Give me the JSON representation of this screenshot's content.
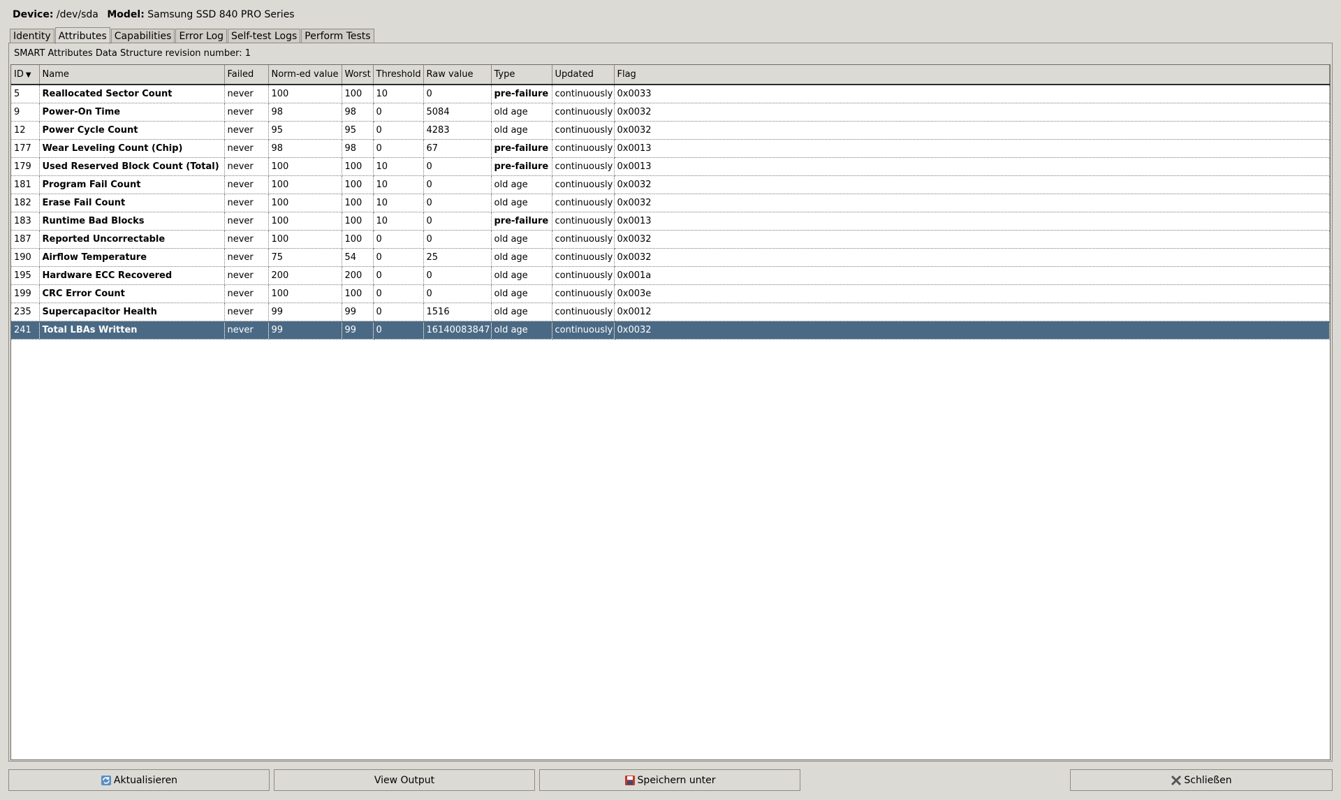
{
  "device": {
    "device_label": "Device:",
    "device_value": "/dev/sda",
    "model_label": "Model:",
    "model_value": "Samsung SSD 840 PRO Series"
  },
  "tabs": [
    {
      "label": "Identity",
      "active": false
    },
    {
      "label": "Attributes",
      "active": true
    },
    {
      "label": "Capabilities",
      "active": false
    },
    {
      "label": "Error Log",
      "active": false
    },
    {
      "label": "Self-test Logs",
      "active": false
    },
    {
      "label": "Perform Tests",
      "active": false
    }
  ],
  "revision_text": "SMART Attributes Data Structure revision number: 1",
  "table": {
    "columns": [
      "ID",
      "Name",
      "Failed",
      "Norm-ed value",
      "Worst",
      "Threshold",
      "Raw value",
      "Type",
      "Updated",
      "Flag"
    ],
    "sort_indicator": "▼",
    "rows": [
      {
        "id": "5",
        "name": "Reallocated Sector Count",
        "failed": "never",
        "norm": "100",
        "worst": "100",
        "threshold": "10",
        "raw": "0",
        "type": "pre-failure",
        "updated": "continuously",
        "flag": "0x0033"
      },
      {
        "id": "9",
        "name": "Power-On Time",
        "failed": "never",
        "norm": "98",
        "worst": "98",
        "threshold": "0",
        "raw": "5084",
        "type": "old age",
        "updated": "continuously",
        "flag": "0x0032"
      },
      {
        "id": "12",
        "name": "Power Cycle Count",
        "failed": "never",
        "norm": "95",
        "worst": "95",
        "threshold": "0",
        "raw": "4283",
        "type": "old age",
        "updated": "continuously",
        "flag": "0x0032"
      },
      {
        "id": "177",
        "name": "Wear Leveling Count (Chip)",
        "failed": "never",
        "norm": "98",
        "worst": "98",
        "threshold": "0",
        "raw": "67",
        "type": "pre-failure",
        "updated": "continuously",
        "flag": "0x0013"
      },
      {
        "id": "179",
        "name": "Used Reserved Block Count (Total)",
        "failed": "never",
        "norm": "100",
        "worst": "100",
        "threshold": "10",
        "raw": "0",
        "type": "pre-failure",
        "updated": "continuously",
        "flag": "0x0013"
      },
      {
        "id": "181",
        "name": "Program Fail Count",
        "failed": "never",
        "norm": "100",
        "worst": "100",
        "threshold": "10",
        "raw": "0",
        "type": "old age",
        "updated": "continuously",
        "flag": "0x0032"
      },
      {
        "id": "182",
        "name": "Erase Fail Count",
        "failed": "never",
        "norm": "100",
        "worst": "100",
        "threshold": "10",
        "raw": "0",
        "type": "old age",
        "updated": "continuously",
        "flag": "0x0032"
      },
      {
        "id": "183",
        "name": "Runtime Bad Blocks",
        "failed": "never",
        "norm": "100",
        "worst": "100",
        "threshold": "10",
        "raw": "0",
        "type": "pre-failure",
        "updated": "continuously",
        "flag": "0x0013"
      },
      {
        "id": "187",
        "name": "Reported Uncorrectable",
        "failed": "never",
        "norm": "100",
        "worst": "100",
        "threshold": "0",
        "raw": "0",
        "type": "old age",
        "updated": "continuously",
        "flag": "0x0032"
      },
      {
        "id": "190",
        "name": "Airflow Temperature",
        "failed": "never",
        "norm": "75",
        "worst": "54",
        "threshold": "0",
        "raw": "25",
        "type": "old age",
        "updated": "continuously",
        "flag": "0x0032"
      },
      {
        "id": "195",
        "name": "Hardware ECC Recovered",
        "failed": "never",
        "norm": "200",
        "worst": "200",
        "threshold": "0",
        "raw": "0",
        "type": "old age",
        "updated": "continuously",
        "flag": "0x001a"
      },
      {
        "id": "199",
        "name": "CRC Error Count",
        "failed": "never",
        "norm": "100",
        "worst": "100",
        "threshold": "0",
        "raw": "0",
        "type": "old age",
        "updated": "continuously",
        "flag": "0x003e"
      },
      {
        "id": "235",
        "name": "Supercapacitor Health",
        "failed": "never",
        "norm": "99",
        "worst": "99",
        "threshold": "0",
        "raw": "1516",
        "type": "old age",
        "updated": "continuously",
        "flag": "0x0012"
      },
      {
        "id": "241",
        "name": "Total LBAs Written",
        "failed": "never",
        "norm": "99",
        "worst": "99",
        "threshold": "0",
        "raw": "16140083847",
        "type": "old age",
        "updated": "continuously",
        "flag": "0x0032",
        "selected": true
      }
    ]
  },
  "buttons": {
    "refresh": {
      "label": "Aktualisieren",
      "icon": "refresh-icon"
    },
    "view_output": {
      "label": "View Output"
    },
    "save_as": {
      "label": "Speichern unter",
      "icon": "save-icon"
    },
    "close": {
      "label": "Schließen",
      "icon": "close-icon"
    }
  },
  "colors": {
    "selected_row": "#4a6984",
    "window_bg": "#dcdad5"
  }
}
